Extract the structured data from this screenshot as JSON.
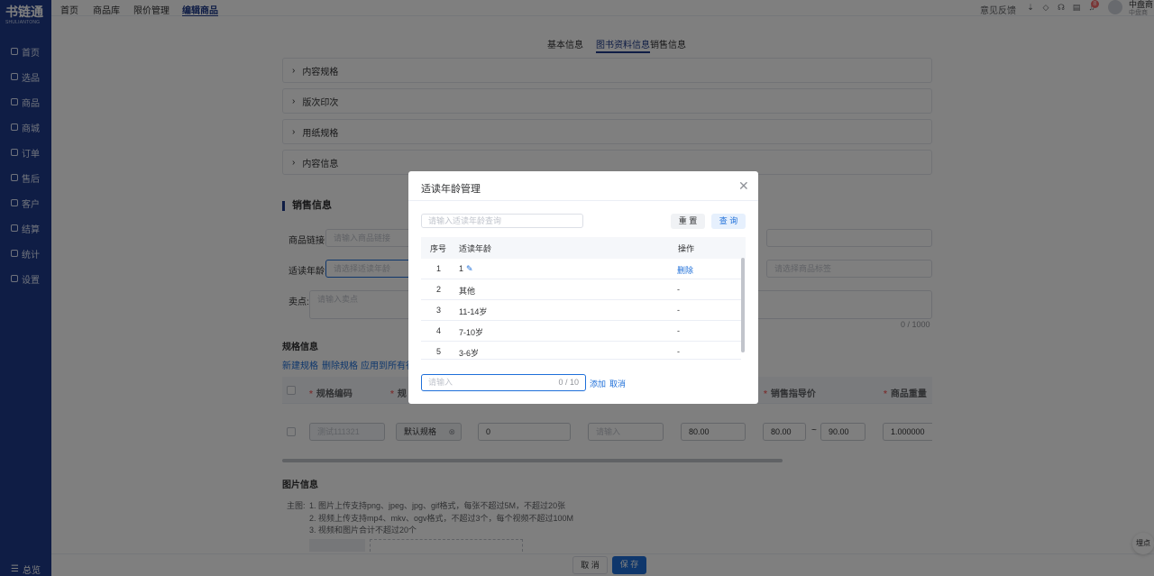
{
  "brand": {
    "logo": "书链通",
    "sub": "SHULIANTONG"
  },
  "sidebar": {
    "items": [
      {
        "label": "首页"
      },
      {
        "label": "选品"
      },
      {
        "label": "商品"
      },
      {
        "label": "商城"
      },
      {
        "label": "订单"
      },
      {
        "label": "售后"
      },
      {
        "label": "客户"
      },
      {
        "label": "结算"
      },
      {
        "label": "统计"
      },
      {
        "label": "设置"
      }
    ],
    "bottom": "总览"
  },
  "topnav": {
    "tabs": [
      "首页",
      "商品库",
      "限价管理",
      "编辑商品"
    ],
    "active": "编辑商品"
  },
  "header": {
    "feedback": "意见反馈",
    "badge": "8",
    "user_name": "中盘商",
    "user_sub": "中盘商"
  },
  "section_tabs": [
    "基本信息",
    "图书资料信息",
    "销售信息"
  ],
  "collapses": [
    "内容规格",
    "版次印次",
    "用纸规格",
    "内容信息"
  ],
  "sales": {
    "title": "销售信息",
    "link_label": "商品链接:",
    "link_placeholder": "请输入商品链接",
    "age_label": "适读年龄:",
    "age_placeholder": "请选择适读年龄",
    "tag_placeholder": "请选择商品标签",
    "selling_label": "卖点:",
    "selling_placeholder": "请输入卖点",
    "selling_count": "0 / 1000"
  },
  "spec": {
    "title": "规格信息",
    "actions": [
      "新建规格",
      "删除规格",
      "应用到所有行"
    ],
    "headers": [
      "规格编码",
      "规",
      "销售指导价",
      "商品重量"
    ],
    "row": {
      "code": "测试111321",
      "name": "默认规格",
      "v1": "0",
      "v2_placeholder": "请输入",
      "v3": "80.00",
      "price_min": "80.00",
      "tilde": "~",
      "price_max": "90.00",
      "weight": "1.000000"
    }
  },
  "images": {
    "title": "图片信息",
    "label": "主图:",
    "notes": [
      "1. 图片上传支持png、jpeg、jpg、gif格式，每张不超过5M，不超过20张",
      "2. 视频上传支持mp4、mkv、ogv格式，不超过3个，每个视频不超过100M",
      "3. 视频和图片合计不超过20个"
    ]
  },
  "footer": {
    "cancel": "取 消",
    "save": "保 存"
  },
  "float_btn": "埋点",
  "modal": {
    "title": "适读年龄管理",
    "search_placeholder": "请输入适读年龄查询",
    "reset": "重 置",
    "query": "查 询",
    "headers": [
      "序号",
      "适读年龄",
      "操作"
    ],
    "rows": [
      {
        "no": "1",
        "age": "1",
        "op": "删除"
      },
      {
        "no": "2",
        "age": "其他",
        "op": "-"
      },
      {
        "no": "3",
        "age": "11-14岁",
        "op": "-"
      },
      {
        "no": "4",
        "age": "7-10岁",
        "op": "-"
      },
      {
        "no": "5",
        "age": "3-6岁",
        "op": "-"
      }
    ],
    "add_placeholder": "请输入",
    "add_count": "0 / 10",
    "add": "添加",
    "cancel": "取消"
  },
  "colors": {
    "primary": "#1e3a8a",
    "link": "#1e6fd9",
    "danger": "#f56c6c"
  }
}
